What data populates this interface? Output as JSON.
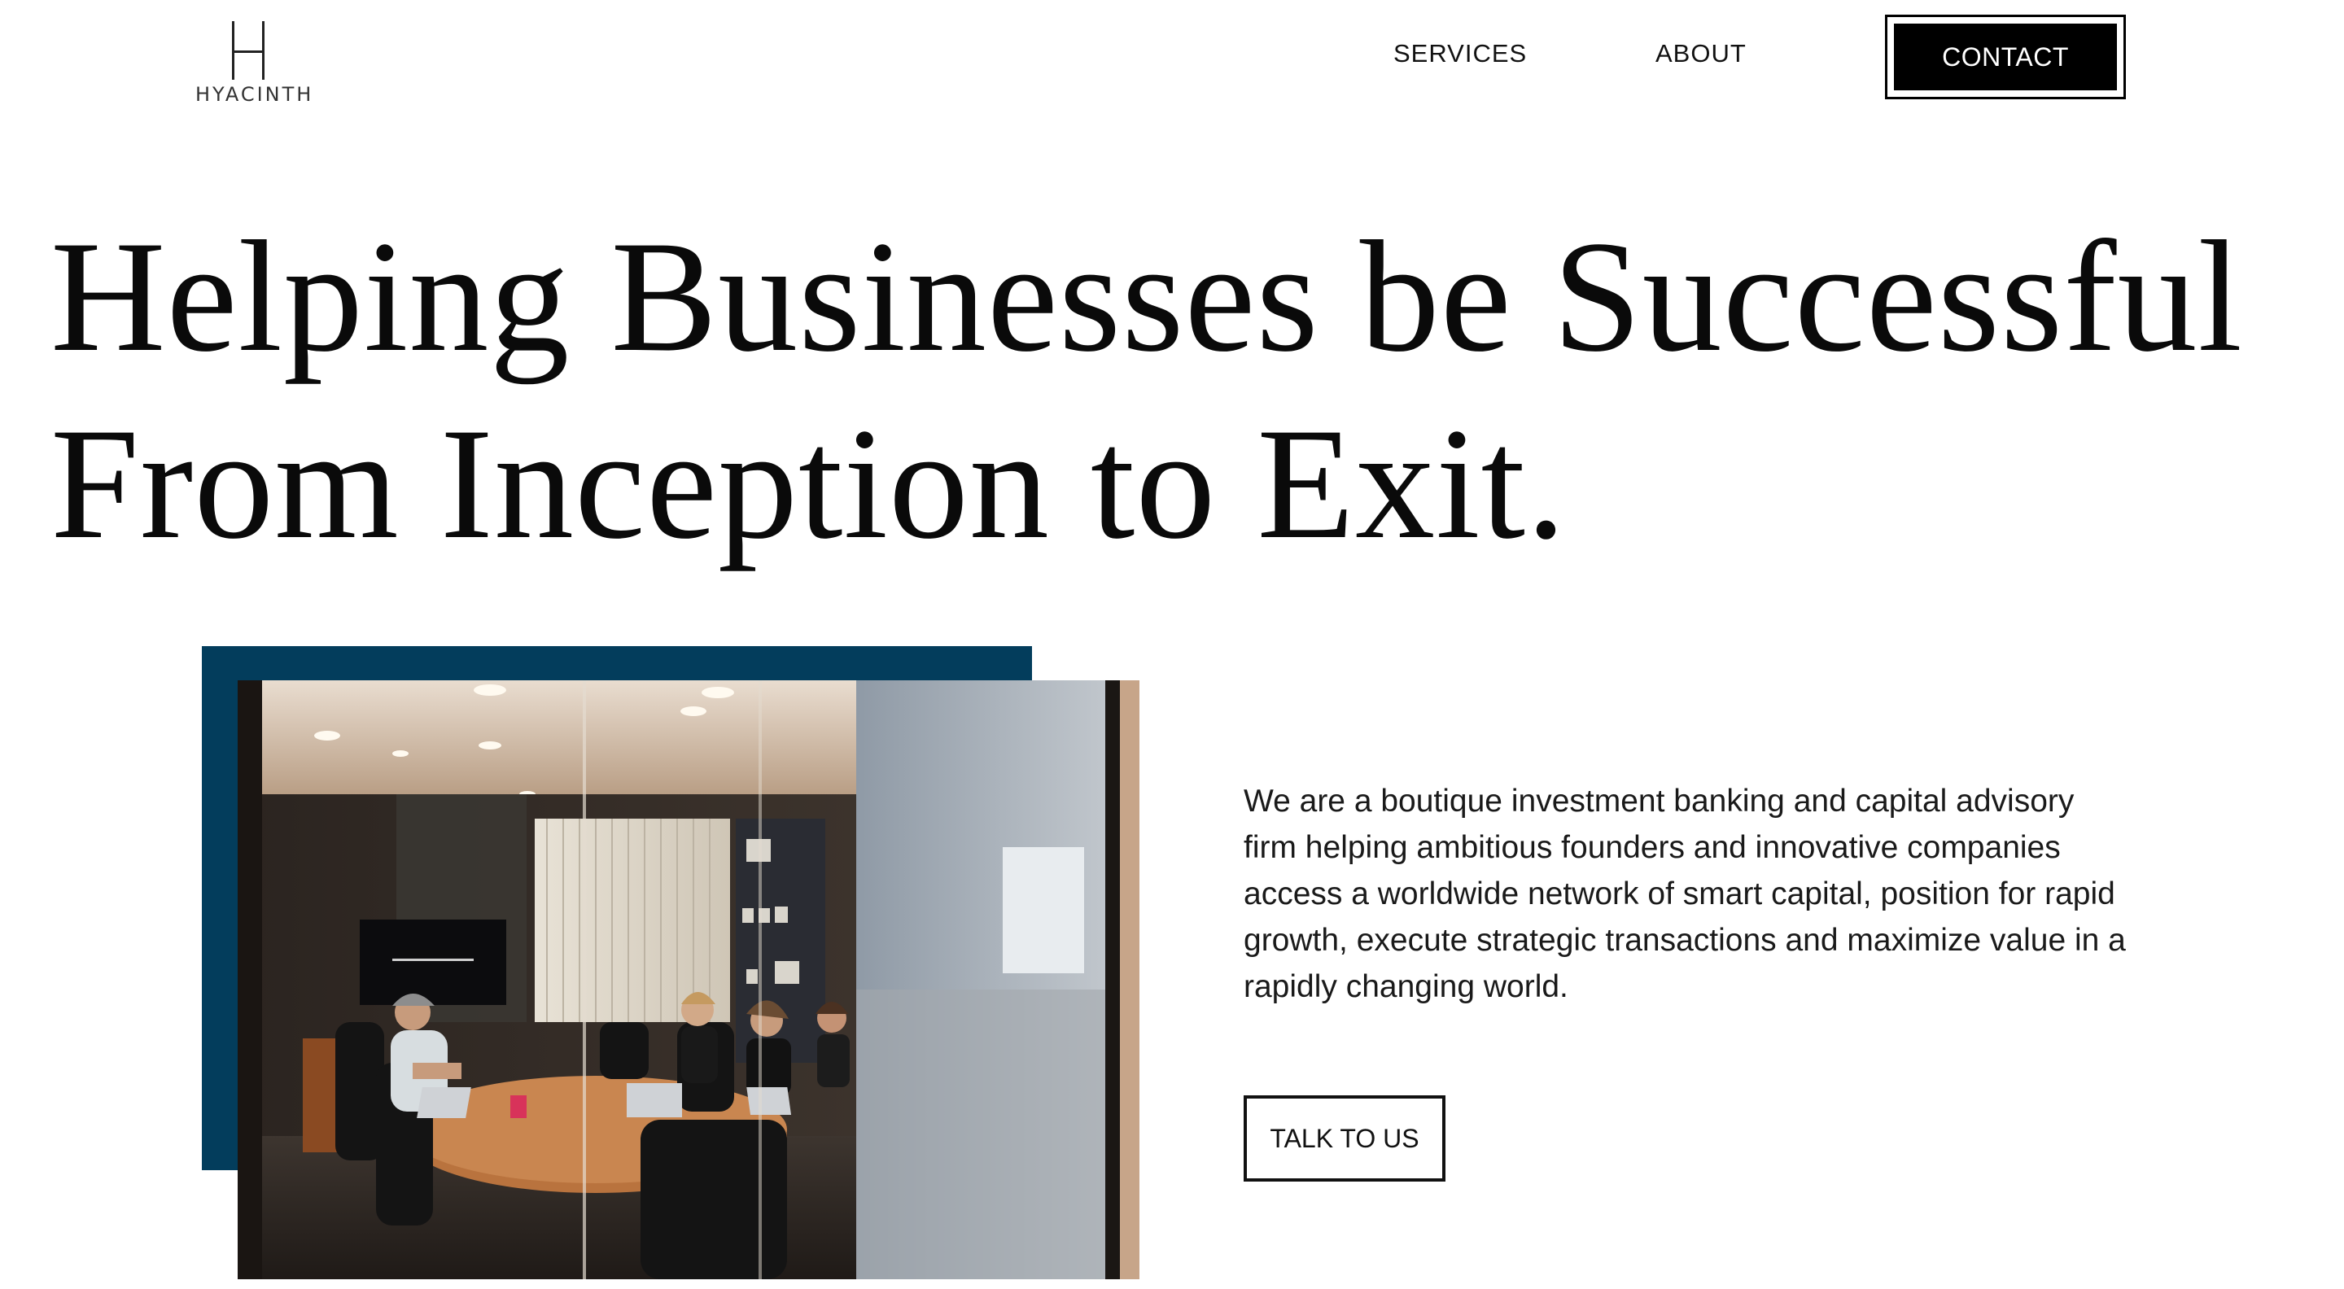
{
  "header": {
    "logo_text": "HYACINTH",
    "nav": {
      "services": "SERVICES",
      "about": "ABOUT",
      "contact": "CONTACT"
    }
  },
  "hero": {
    "headline_line1": "Helping Businesses be Successful",
    "headline_line2": "From Inception to Exit.",
    "intro": "We are a boutique investment banking and capital advisory firm helping ambitious founders and innovative companies access a worldwide network of smart capital, position for rapid growth, execute strategic transactions and maximize value in a rapidly changing world.",
    "cta": "TALK TO US",
    "photo_alt": "Team meeting in a glass-walled conference room"
  },
  "colors": {
    "accent": "#033d5c",
    "contact_bg": "#000000",
    "text": "#111111"
  }
}
